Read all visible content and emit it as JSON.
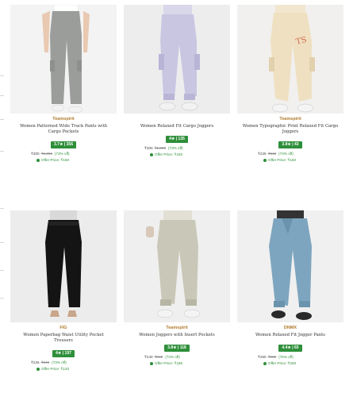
{
  "colors": {
    "brand": "#b07a2a",
    "rating_bg": "#2e8f3a",
    "offer": "#2e8f3a"
  },
  "products": [
    {
      "brand": "Teamspirit",
      "title": "Women Patterned Wide Track Pants with Cargo Pockets",
      "rating": "3.7★ | 356",
      "price": "₹300",
      "mrp": "₹1,099",
      "discount": "(73% off)",
      "offer": "Offer Price: ₹150",
      "pant_color": "#9a9d9a",
      "top_color": "#ffffff",
      "shoe_color": "#f2f2f2",
      "bg": "#f3f3f3"
    },
    {
      "brand": "",
      "title": "Women Relaxed Fit Cargo Joggers",
      "rating": "4★ | 135",
      "price": "₹300",
      "mrp": "₹1,099",
      "discount": "(73% off)",
      "offer": "Offer Price: ₹150",
      "pant_color": "#c9c6e2",
      "top_color": "#d9d7ea",
      "shoe_color": "#f2f2f2",
      "bg": "#ededee"
    },
    {
      "brand": "Teamspirit",
      "title": "Women Typographic Print Relaxed Fit Cargo Joggers",
      "rating": "3.8★ | 43",
      "price": "₹225",
      "mrp": "₹849",
      "discount": "(73% off)",
      "offer": "Offer Price: ₹150",
      "pant_color": "#efe0c2",
      "top_color": "#f2e6cf",
      "shoe_color": "#f4f4f4",
      "bg": "#f1f0ee"
    },
    {
      "brand": "FIG",
      "title": "Women Paperbag Waist Utility Pocket Trousers",
      "rating": "4★ | 197",
      "price": "₹225",
      "mrp": "₹849",
      "discount": "(73% off)",
      "offer": "Offer Price: ₹120",
      "pant_color": "#141414",
      "top_color": "#d9d9d9",
      "shoe_color": "#c9a58a",
      "bg": "#ececec"
    },
    {
      "brand": "Teamspirit",
      "title": "Women Joggers with Insert Pockets",
      "rating": "3.8★ | 118",
      "price": "₹240",
      "mrp": "₹849",
      "discount": "(73% off)",
      "offer": "Offer Price: ₹185",
      "pant_color": "#c9c7b7",
      "top_color": "#e2e0d4",
      "shoe_color": "#f4f4f4",
      "bg": "#efefef"
    },
    {
      "brand": "DNMX",
      "title": "Women Relaxed Fit Jogger Pants",
      "rating": "4.4★ | 65",
      "price": "₹250",
      "mrp": "₹999",
      "discount": "(75% off)",
      "offer": "Offer Price: ₹200",
      "pant_color": "#7ea5bf",
      "top_color": "#333333",
      "shoe_color": "#2a2a2a",
      "bg": "#f0f0f0"
    }
  ]
}
